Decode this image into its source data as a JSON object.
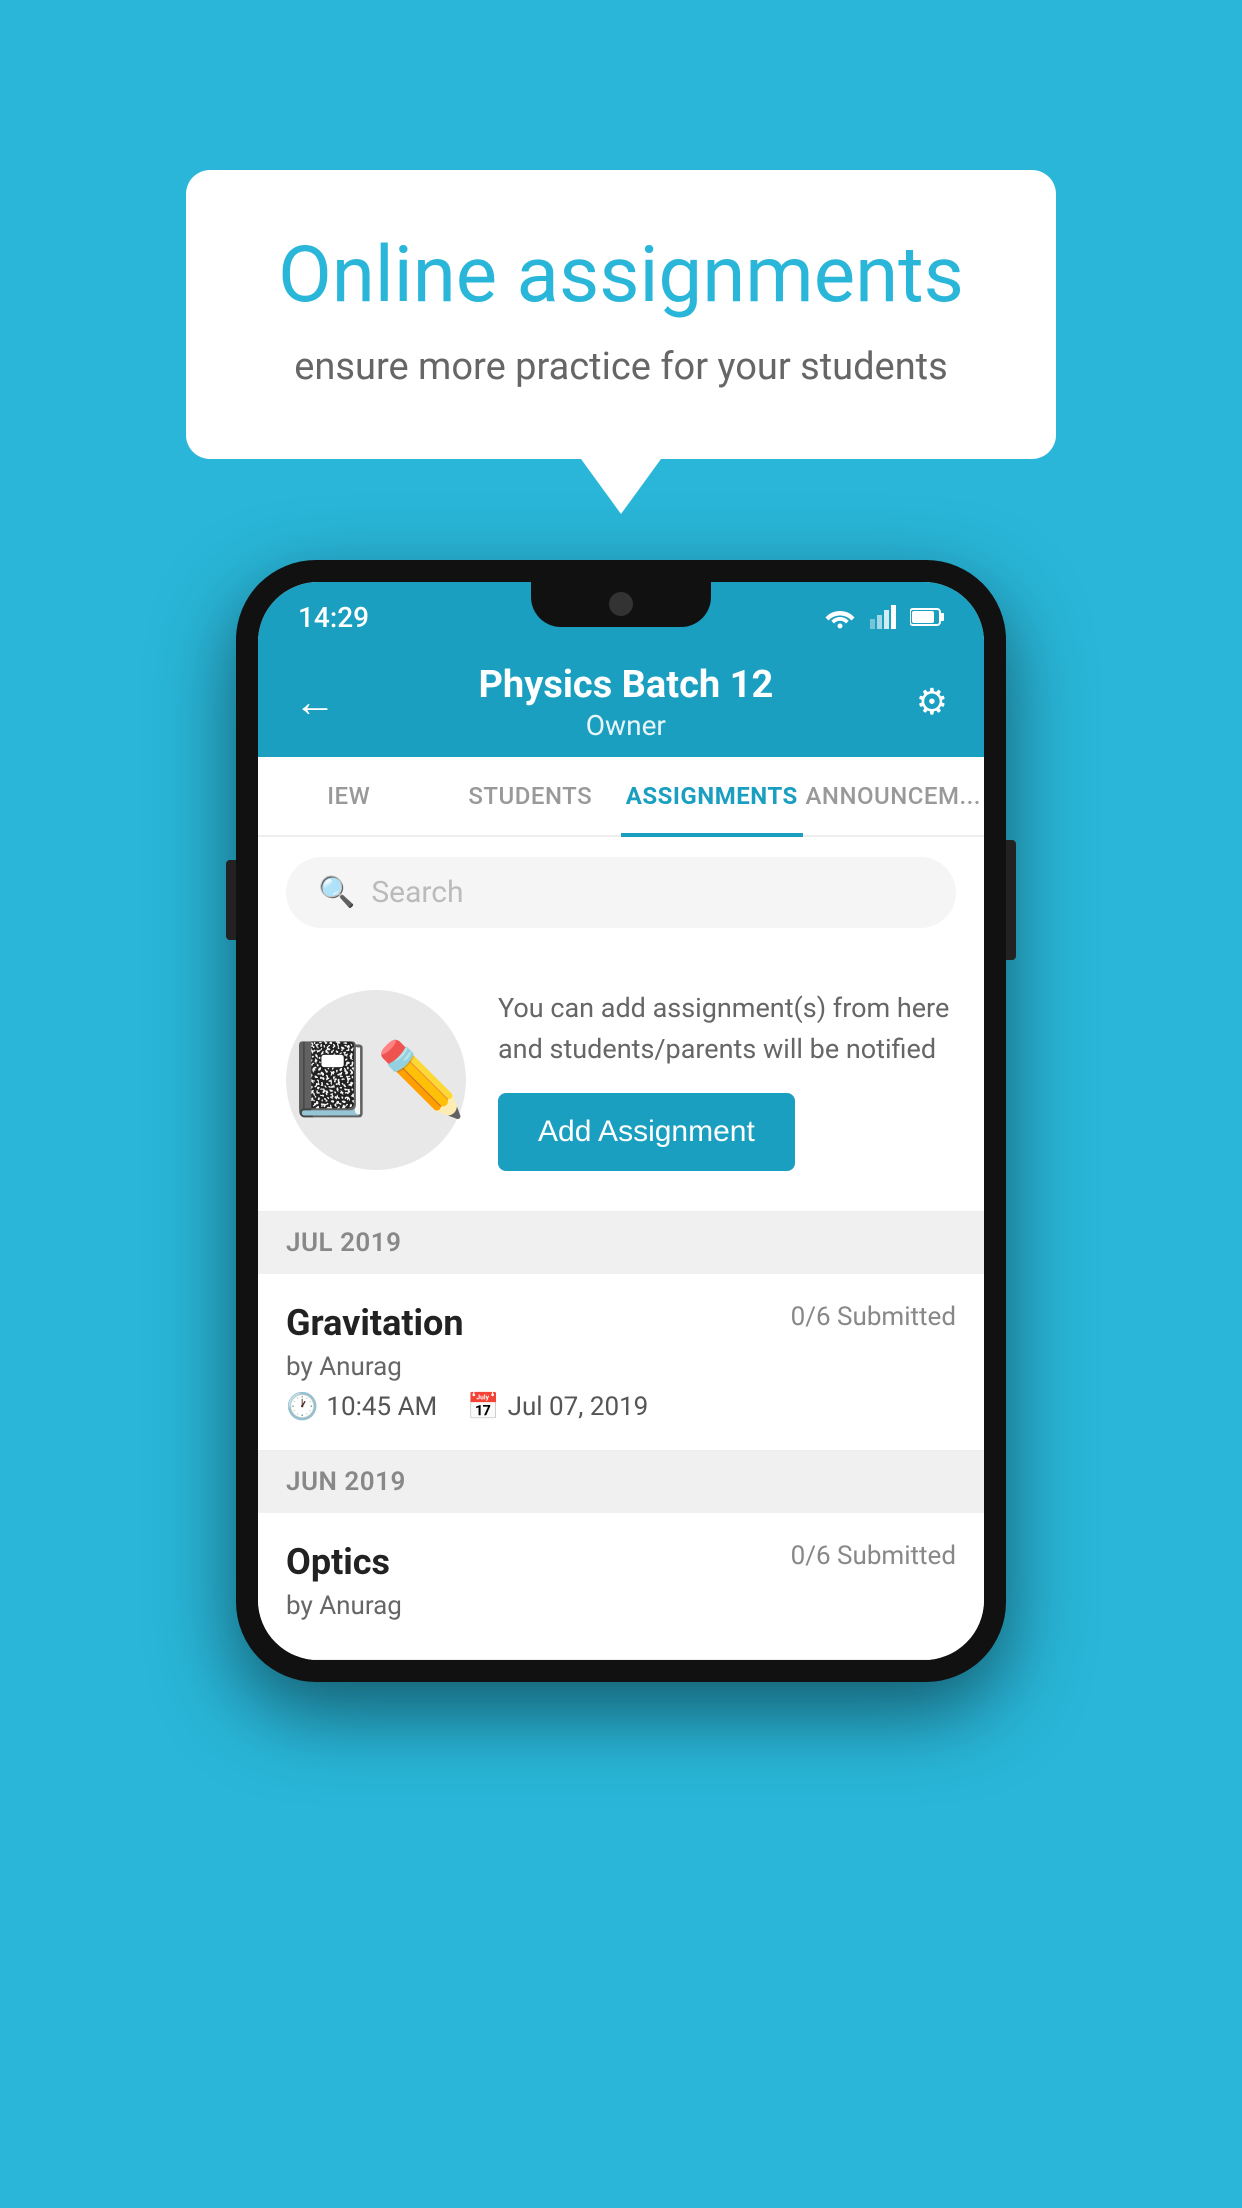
{
  "background_color": "#29b6d8",
  "speech_bubble": {
    "title": "Online assignments",
    "subtitle": "ensure more practice for your students"
  },
  "status_bar": {
    "time": "14:29"
  },
  "header": {
    "title": "Physics Batch 12",
    "subtitle": "Owner",
    "back_label": "←",
    "gear_label": "⚙"
  },
  "tabs": [
    {
      "label": "IEW",
      "active": false
    },
    {
      "label": "STUDENTS",
      "active": false
    },
    {
      "label": "ASSIGNMENTS",
      "active": true
    },
    {
      "label": "ANNOUNCEM...",
      "active": false
    }
  ],
  "search": {
    "placeholder": "Search"
  },
  "empty_state": {
    "description": "You can add assignment(s) from here and students/parents will be notified",
    "button_label": "Add Assignment"
  },
  "sections": [
    {
      "month": "JUL 2019",
      "assignments": [
        {
          "name": "Gravitation",
          "submitted": "0/6 Submitted",
          "by": "by Anurag",
          "time": "10:45 AM",
          "date": "Jul 07, 2019"
        }
      ]
    },
    {
      "month": "JUN 2019",
      "assignments": [
        {
          "name": "Optics",
          "submitted": "0/6 Submitted",
          "by": "by Anurag",
          "time": "",
          "date": ""
        }
      ]
    }
  ]
}
